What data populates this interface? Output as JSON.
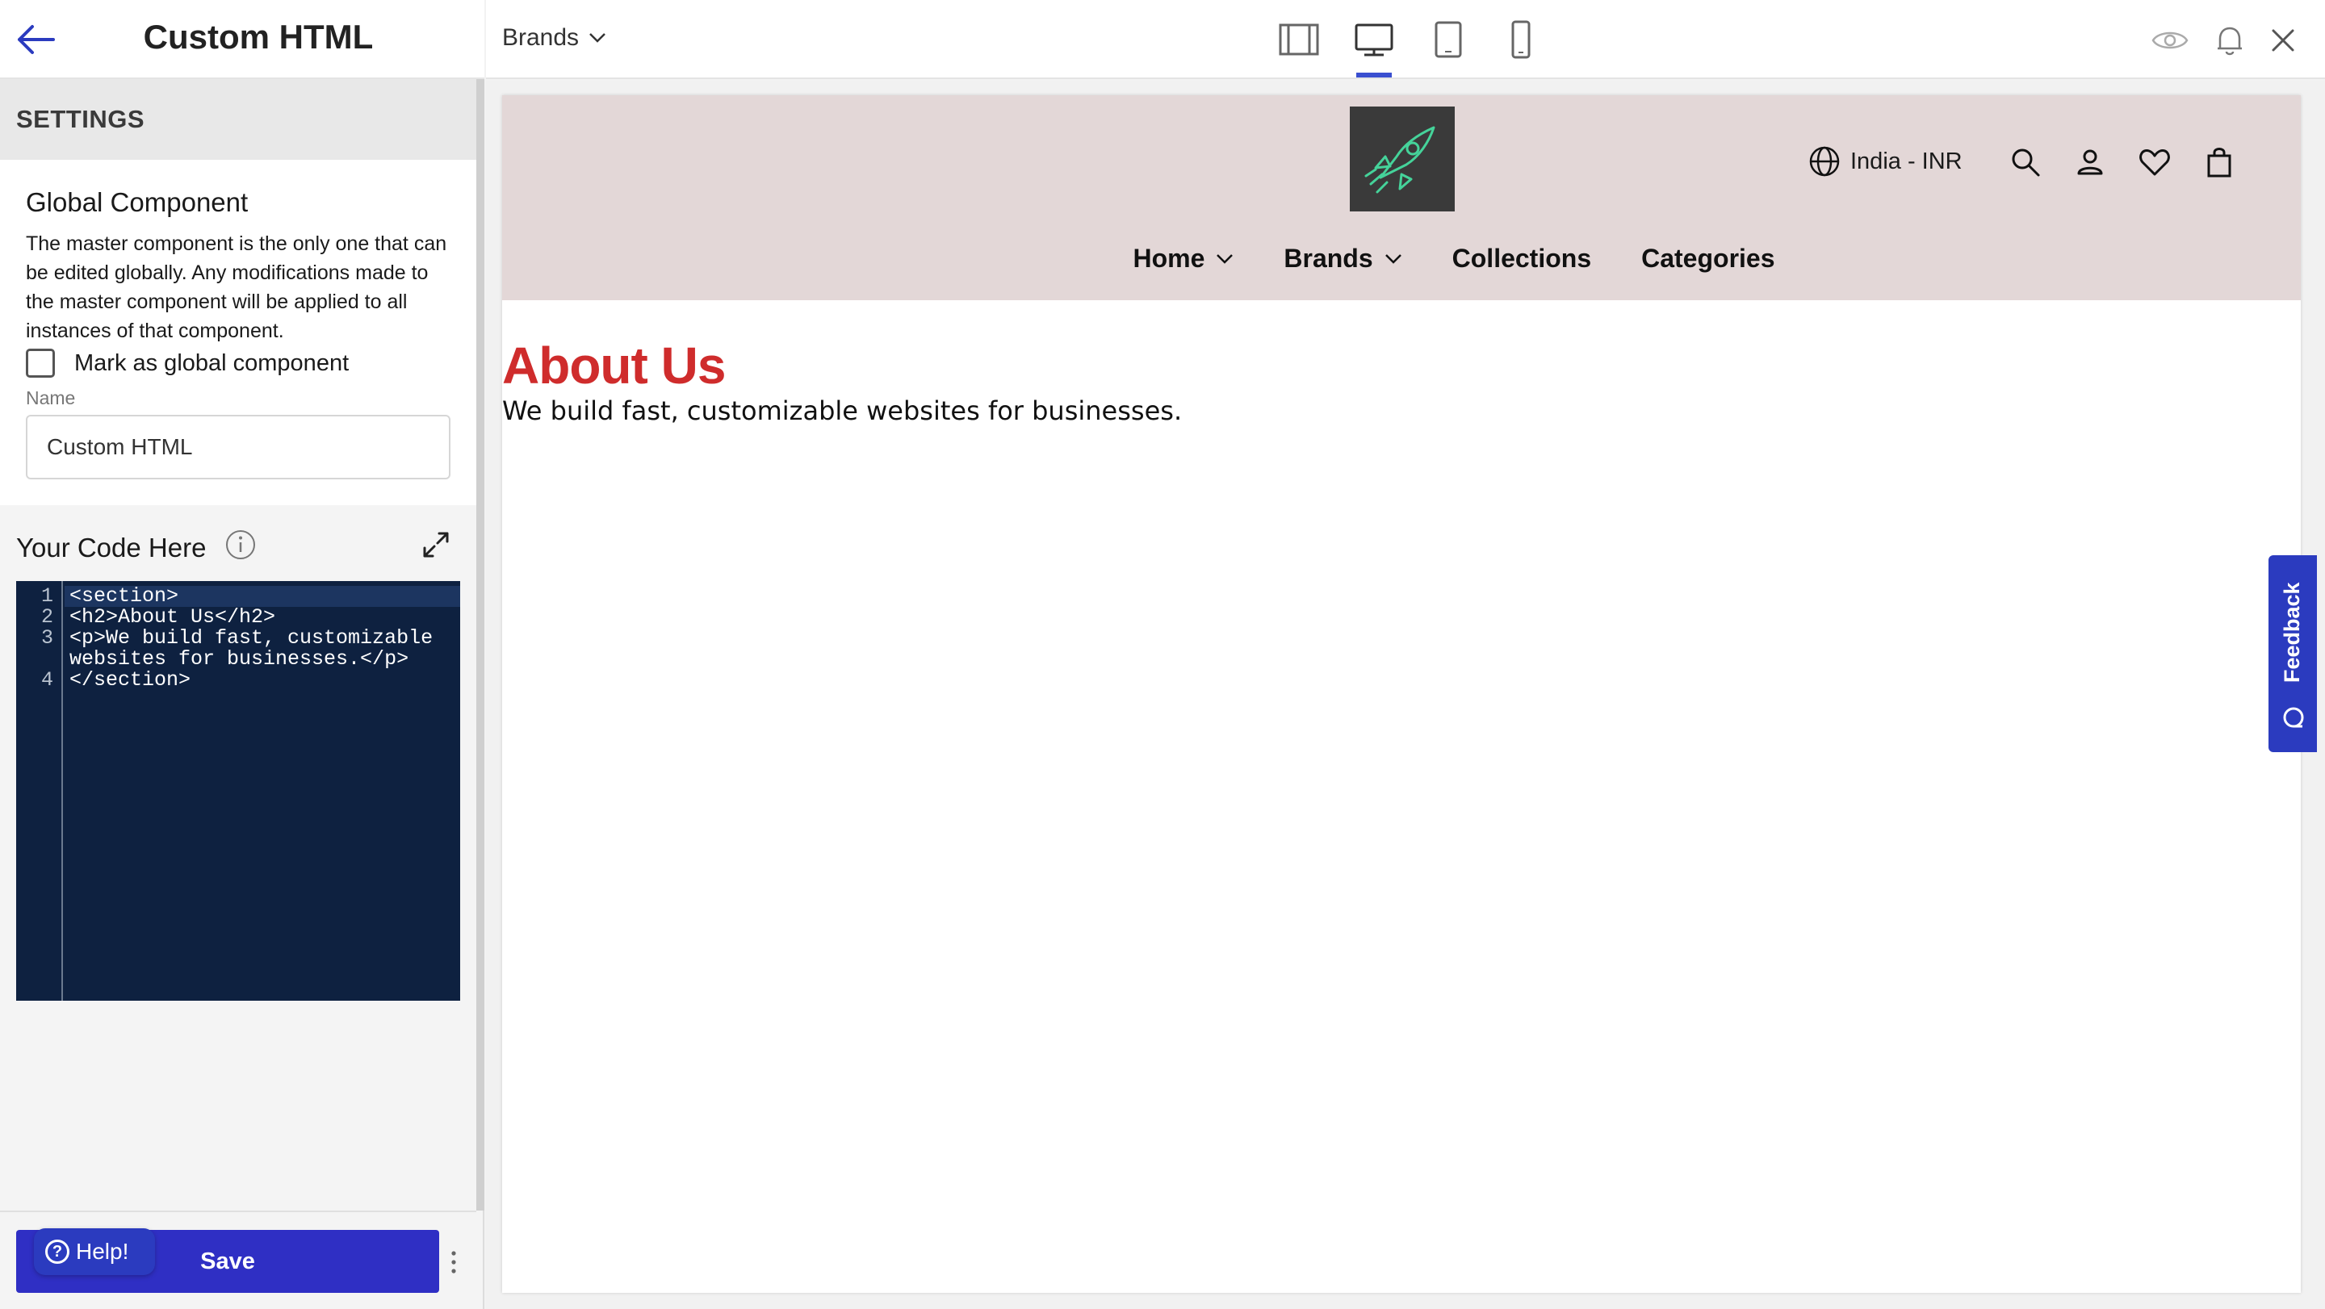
{
  "sidebar": {
    "title": "Custom HTML",
    "settings_label": "SETTINGS",
    "global_component": {
      "title": "Global Component",
      "description": "The master component is the only one that can be edited globally. Any modifications made to the master component will be applied to all instances of that component.",
      "checkbox_label": "Mark as global component",
      "checked": false,
      "name_label": "Name",
      "name_value": "Custom HTML"
    },
    "code": {
      "title": "Your Code Here",
      "lines": [
        {
          "num": "1",
          "text": "<section>"
        },
        {
          "num": "2",
          "text": "<h2>About Us</h2>"
        },
        {
          "num": "3",
          "text": "<p>We build fast, customizable"
        },
        {
          "num": "",
          "text": "websites for businesses.</p>"
        },
        {
          "num": "4",
          "text": "</section>"
        }
      ]
    },
    "save_label": "Save",
    "help_label": "Help!"
  },
  "topbar": {
    "page_select": "Brands",
    "devices": [
      "sidebar-layout-icon",
      "desktop-icon",
      "tablet-icon",
      "mobile-icon"
    ],
    "active_device": "desktop-icon"
  },
  "preview": {
    "currency": "India - INR",
    "nav": [
      {
        "label": "Home",
        "dropdown": true
      },
      {
        "label": "Brands",
        "dropdown": true
      },
      {
        "label": "Collections",
        "dropdown": false
      },
      {
        "label": "Categories",
        "dropdown": false
      }
    ],
    "heading": "About Us",
    "paragraph": "We build fast, customizable websites for businesses."
  },
  "feedback_label": "Feedback",
  "colors": {
    "accent": "#2f2fc4",
    "header_bg": "#e3d7d7",
    "heading_red": "#cf2c2c",
    "editor_bg": "#0e2140"
  }
}
